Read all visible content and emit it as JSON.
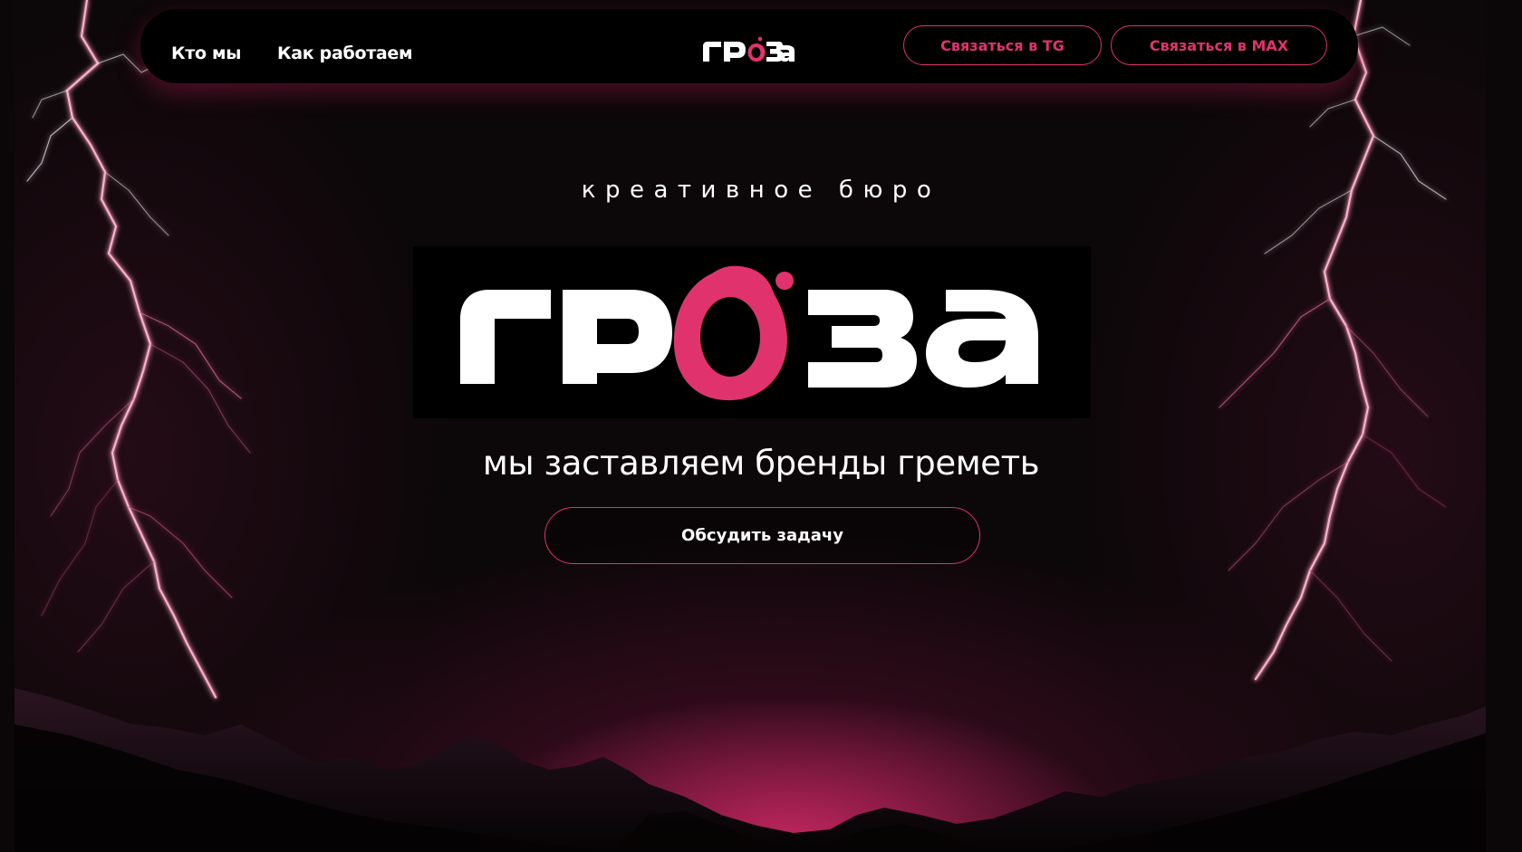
{
  "nav": {
    "links": [
      {
        "label": "Кто мы"
      },
      {
        "label": "Как работаем"
      }
    ],
    "logo_text": "гроза",
    "buttons": {
      "tg": "Связаться в TG",
      "max": "Связаться в MAX"
    }
  },
  "hero": {
    "eyebrow": "креативное бюро",
    "logo_text": "гроза",
    "tagline": "мы заставляем бренды греметь",
    "cta": "Обсудить задачу"
  },
  "colors": {
    "accent": "#e0336e",
    "background": "#0c0709",
    "text": "#ffffff"
  },
  "icons": {
    "logo_mark": "pink-droplet-o-logo"
  }
}
